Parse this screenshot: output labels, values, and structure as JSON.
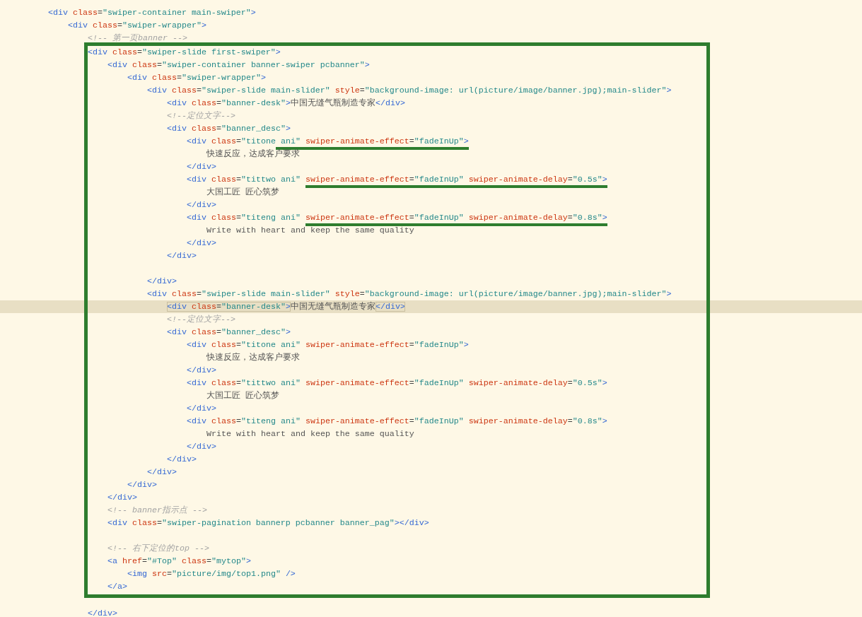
{
  "editor": {
    "lines": [
      {
        "kind": "code",
        "tokens": [
          {
            "kind": "tag",
            "text": "<div "
          },
          {
            "kind": "attr",
            "text": "class"
          },
          {
            "kind": "eq",
            "text": "="
          },
          {
            "kind": "str",
            "text": "\"swiper-container main-swiper\""
          },
          {
            "kind": "tag",
            "text": ">"
          }
        ],
        "children": [
          {
            "kind": "code",
            "tokens": [
              {
                "kind": "tag",
                "text": "<div "
              },
              {
                "kind": "attr",
                "text": "class"
              },
              {
                "kind": "eq",
                "text": "="
              },
              {
                "kind": "str",
                "text": "\"swiper-wrapper\""
              },
              {
                "kind": "tag",
                "text": ">"
              }
            ],
            "children": [
              {
                "kind": "code",
                "tokens": [
                  {
                    "kind": "comment",
                    "text": "<!-- 第一页banner -->"
                  }
                ]
              },
              {
                "kind": "code",
                "framed": true,
                "tokens": [
                  {
                    "kind": "tag",
                    "text": "<div "
                  },
                  {
                    "kind": "attr",
                    "text": "class"
                  },
                  {
                    "kind": "eq",
                    "text": "="
                  },
                  {
                    "kind": "str",
                    "text": "\"swiper-slide first-swiper\""
                  },
                  {
                    "kind": "tag",
                    "text": ">"
                  }
                ],
                "children": [
                  {
                    "kind": "code",
                    "tokens": [
                      {
                        "kind": "tag",
                        "text": "<div "
                      },
                      {
                        "kind": "attr",
                        "text": "class"
                      },
                      {
                        "kind": "eq",
                        "text": "="
                      },
                      {
                        "kind": "str",
                        "text": "\"swiper-container banner-swiper pcbanner\""
                      },
                      {
                        "kind": "tag",
                        "text": ">"
                      }
                    ],
                    "children": [
                      {
                        "kind": "code",
                        "tokens": [
                          {
                            "kind": "tag",
                            "text": "<div "
                          },
                          {
                            "kind": "attr",
                            "text": "class"
                          },
                          {
                            "kind": "eq",
                            "text": "="
                          },
                          {
                            "kind": "str",
                            "text": "\"swiper-wrapper\""
                          },
                          {
                            "kind": "tag",
                            "text": ">"
                          }
                        ],
                        "children": [
                          {
                            "kind": "code",
                            "tokens": [
                              {
                                "kind": "tag",
                                "text": "<div "
                              },
                              {
                                "kind": "attr",
                                "text": "class"
                              },
                              {
                                "kind": "eq",
                                "text": "="
                              },
                              {
                                "kind": "str",
                                "text": "\"swiper-slide main-slider\" "
                              },
                              {
                                "kind": "attr",
                                "text": "style"
                              },
                              {
                                "kind": "eq",
                                "text": "="
                              },
                              {
                                "kind": "str",
                                "text": "\"background-image: url(picture/image/banner.jpg);main-slider\""
                              },
                              {
                                "kind": "tag",
                                "text": ">"
                              }
                            ],
                            "children": [
                              {
                                "kind": "code",
                                "tokens": [
                                  {
                                    "kind": "tag",
                                    "text": "<div "
                                  },
                                  {
                                    "kind": "attr",
                                    "text": "class"
                                  },
                                  {
                                    "kind": "eq",
                                    "text": "="
                                  },
                                  {
                                    "kind": "str",
                                    "text": "\"banner-desk\""
                                  },
                                  {
                                    "kind": "tag",
                                    "text": ">"
                                  },
                                  {
                                    "kind": "text",
                                    "text": "中国无缝气瓶制造专家"
                                  },
                                  {
                                    "kind": "tag",
                                    "text": "</div>"
                                  }
                                ]
                              },
                              {
                                "kind": "code",
                                "tokens": [
                                  {
                                    "kind": "comment",
                                    "text": "<!--定位文字-->"
                                  }
                                ]
                              },
                              {
                                "kind": "code",
                                "tokens": [
                                  {
                                    "kind": "tag",
                                    "text": "<div "
                                  },
                                  {
                                    "kind": "attr",
                                    "text": "class"
                                  },
                                  {
                                    "kind": "eq",
                                    "text": "="
                                  },
                                  {
                                    "kind": "str",
                                    "text": "\"banner_desc\""
                                  },
                                  {
                                    "kind": "tag",
                                    "text": ">"
                                  }
                                ],
                                "children": [
                                  {
                                    "kind": "code",
                                    "tokens": [
                                      {
                                        "kind": "tag",
                                        "text": "<div "
                                      },
                                      {
                                        "kind": "attr",
                                        "text": "class"
                                      },
                                      {
                                        "kind": "eq",
                                        "text": "="
                                      },
                                      {
                                        "kind": "str",
                                        "text": "\"titone"
                                      },
                                      {
                                        "kind": "underline",
                                        "tokens": [
                                          {
                                            "kind": "str",
                                            "text": " ani\" "
                                          },
                                          {
                                            "kind": "attr",
                                            "text": "swiper-animate-effect"
                                          },
                                          {
                                            "kind": "eq",
                                            "text": "="
                                          },
                                          {
                                            "kind": "str",
                                            "text": "\"fadeInUp\""
                                          },
                                          {
                                            "kind": "tag",
                                            "text": ">"
                                          }
                                        ]
                                      }
                                    ],
                                    "children": [
                                      {
                                        "kind": "code",
                                        "tokens": [
                                          {
                                            "kind": "text",
                                            "text": "快速反应，达成客户要求"
                                          }
                                        ]
                                      }
                                    ]
                                  },
                                  {
                                    "kind": "code",
                                    "tokens": [
                                      {
                                        "kind": "tag",
                                        "text": "</div>"
                                      }
                                    ]
                                  },
                                  {
                                    "kind": "code",
                                    "tokens": [
                                      {
                                        "kind": "tag",
                                        "text": "<div "
                                      },
                                      {
                                        "kind": "attr",
                                        "text": "class"
                                      },
                                      {
                                        "kind": "eq",
                                        "text": "="
                                      },
                                      {
                                        "kind": "str",
                                        "text": "\"tittwo ani\" "
                                      },
                                      {
                                        "kind": "underline",
                                        "tokens": [
                                          {
                                            "kind": "attr",
                                            "text": "swiper-animate-effect"
                                          },
                                          {
                                            "kind": "eq",
                                            "text": "="
                                          },
                                          {
                                            "kind": "str",
                                            "text": "\"fadeInUp\" "
                                          },
                                          {
                                            "kind": "attr",
                                            "text": "swiper-animate-delay"
                                          },
                                          {
                                            "kind": "eq",
                                            "text": "="
                                          },
                                          {
                                            "kind": "str",
                                            "text": "\"0.5s\""
                                          },
                                          {
                                            "kind": "tag",
                                            "text": ">"
                                          }
                                        ]
                                      }
                                    ],
                                    "children": [
                                      {
                                        "kind": "code",
                                        "tokens": [
                                          {
                                            "kind": "text",
                                            "text": "大国工匠 匠心筑梦"
                                          }
                                        ]
                                      }
                                    ]
                                  },
                                  {
                                    "kind": "code",
                                    "tokens": [
                                      {
                                        "kind": "tag",
                                        "text": "</div>"
                                      }
                                    ]
                                  },
                                  {
                                    "kind": "code",
                                    "tokens": [
                                      {
                                        "kind": "tag",
                                        "text": "<div "
                                      },
                                      {
                                        "kind": "attr",
                                        "text": "class"
                                      },
                                      {
                                        "kind": "eq",
                                        "text": "="
                                      },
                                      {
                                        "kind": "str",
                                        "text": "\"titeng ani\" "
                                      },
                                      {
                                        "kind": "underline",
                                        "tokens": [
                                          {
                                            "kind": "attr",
                                            "text": "swiper-animate-effect"
                                          },
                                          {
                                            "kind": "eq",
                                            "text": "="
                                          },
                                          {
                                            "kind": "str",
                                            "text": "\"fadeInUp\" "
                                          },
                                          {
                                            "kind": "attr",
                                            "text": "swiper-animate-delay"
                                          },
                                          {
                                            "kind": "eq",
                                            "text": "="
                                          },
                                          {
                                            "kind": "str",
                                            "text": "\"0.8s\""
                                          },
                                          {
                                            "kind": "tag",
                                            "text": ">"
                                          }
                                        ]
                                      }
                                    ],
                                    "children": [
                                      {
                                        "kind": "code",
                                        "tokens": [
                                          {
                                            "kind": "text",
                                            "text": "Write with heart and keep the same quality"
                                          }
                                        ]
                                      }
                                    ]
                                  },
                                  {
                                    "kind": "code",
                                    "tokens": [
                                      {
                                        "kind": "tag",
                                        "text": "</div>"
                                      }
                                    ]
                                  }
                                ]
                              },
                              {
                                "kind": "code",
                                "tokens": [
                                  {
                                    "kind": "tag",
                                    "text": "</div>"
                                  }
                                ]
                              },
                              {
                                "kind": "blank"
                              }
                            ]
                          },
                          {
                            "kind": "code",
                            "tokens": [
                              {
                                "kind": "tag",
                                "text": "</div>"
                              }
                            ]
                          },
                          {
                            "kind": "code",
                            "tokens": [
                              {
                                "kind": "tag",
                                "text": "<div "
                              },
                              {
                                "kind": "attr",
                                "text": "class"
                              },
                              {
                                "kind": "eq",
                                "text": "="
                              },
                              {
                                "kind": "str",
                                "text": "\"swiper-slide main-slider\" "
                              },
                              {
                                "kind": "attr",
                                "text": "style"
                              },
                              {
                                "kind": "eq",
                                "text": "="
                              },
                              {
                                "kind": "str",
                                "text": "\"background-image: url(picture/image/banner.jpg);main-slider\""
                              },
                              {
                                "kind": "tag",
                                "text": ">"
                              }
                            ],
                            "children": [
                              {
                                "kind": "code",
                                "current": true,
                                "tokens": [
                                  {
                                    "kind": "match",
                                    "tokens": [
                                      {
                                        "kind": "tag",
                                        "text": "<div "
                                      },
                                      {
                                        "kind": "attr",
                                        "text": "class"
                                      },
                                      {
                                        "kind": "eq",
                                        "text": "="
                                      },
                                      {
                                        "kind": "str",
                                        "text": "\"banner-desk\""
                                      },
                                      {
                                        "kind": "tag",
                                        "text": ">"
                                      }
                                    ]
                                  },
                                  {
                                    "kind": "text",
                                    "text": "中国无缝气瓶制造专家"
                                  },
                                  {
                                    "kind": "match",
                                    "tokens": [
                                      {
                                        "kind": "tag",
                                        "text": "</div>"
                                      }
                                    ]
                                  }
                                ]
                              },
                              {
                                "kind": "code",
                                "tokens": [
                                  {
                                    "kind": "comment",
                                    "text": "<!--定位文字-->"
                                  }
                                ]
                              },
                              {
                                "kind": "code",
                                "tokens": [
                                  {
                                    "kind": "tag",
                                    "text": "<div "
                                  },
                                  {
                                    "kind": "attr",
                                    "text": "class"
                                  },
                                  {
                                    "kind": "eq",
                                    "text": "="
                                  },
                                  {
                                    "kind": "str",
                                    "text": "\"banner_desc\""
                                  },
                                  {
                                    "kind": "tag",
                                    "text": ">"
                                  }
                                ],
                                "children": [
                                  {
                                    "kind": "code",
                                    "tokens": [
                                      {
                                        "kind": "tag",
                                        "text": "<div "
                                      },
                                      {
                                        "kind": "attr",
                                        "text": "class"
                                      },
                                      {
                                        "kind": "eq",
                                        "text": "="
                                      },
                                      {
                                        "kind": "str",
                                        "text": "\"titone ani\" "
                                      },
                                      {
                                        "kind": "attr",
                                        "text": "swiper-animate-effect"
                                      },
                                      {
                                        "kind": "eq",
                                        "text": "="
                                      },
                                      {
                                        "kind": "str",
                                        "text": "\"fadeInUp\""
                                      },
                                      {
                                        "kind": "tag",
                                        "text": ">"
                                      }
                                    ],
                                    "children": [
                                      {
                                        "kind": "code",
                                        "tokens": [
                                          {
                                            "kind": "text",
                                            "text": "快速反应，达成客户要求"
                                          }
                                        ]
                                      }
                                    ]
                                  },
                                  {
                                    "kind": "code",
                                    "tokens": [
                                      {
                                        "kind": "tag",
                                        "text": "</div>"
                                      }
                                    ]
                                  },
                                  {
                                    "kind": "code",
                                    "tokens": [
                                      {
                                        "kind": "tag",
                                        "text": "<div "
                                      },
                                      {
                                        "kind": "attr",
                                        "text": "class"
                                      },
                                      {
                                        "kind": "eq",
                                        "text": "="
                                      },
                                      {
                                        "kind": "str",
                                        "text": "\"tittwo ani\" "
                                      },
                                      {
                                        "kind": "attr",
                                        "text": "swiper-animate-effect"
                                      },
                                      {
                                        "kind": "eq",
                                        "text": "="
                                      },
                                      {
                                        "kind": "str",
                                        "text": "\"fadeInUp\" "
                                      },
                                      {
                                        "kind": "attr",
                                        "text": "swiper-animate-delay"
                                      },
                                      {
                                        "kind": "eq",
                                        "text": "="
                                      },
                                      {
                                        "kind": "str",
                                        "text": "\"0.5s\""
                                      },
                                      {
                                        "kind": "tag",
                                        "text": ">"
                                      }
                                    ],
                                    "children": [
                                      {
                                        "kind": "code",
                                        "tokens": [
                                          {
                                            "kind": "text",
                                            "text": "大国工匠 匠心筑梦"
                                          }
                                        ]
                                      }
                                    ]
                                  },
                                  {
                                    "kind": "code",
                                    "tokens": [
                                      {
                                        "kind": "tag",
                                        "text": "</div>"
                                      }
                                    ]
                                  },
                                  {
                                    "kind": "code",
                                    "tokens": [
                                      {
                                        "kind": "tag",
                                        "text": "<div "
                                      },
                                      {
                                        "kind": "attr",
                                        "text": "class"
                                      },
                                      {
                                        "kind": "eq",
                                        "text": "="
                                      },
                                      {
                                        "kind": "str",
                                        "text": "\"titeng ani\" "
                                      },
                                      {
                                        "kind": "attr",
                                        "text": "swiper-animate-effect"
                                      },
                                      {
                                        "kind": "eq",
                                        "text": "="
                                      },
                                      {
                                        "kind": "str",
                                        "text": "\"fadeInUp\" "
                                      },
                                      {
                                        "kind": "attr",
                                        "text": "swiper-animate-delay"
                                      },
                                      {
                                        "kind": "eq",
                                        "text": "="
                                      },
                                      {
                                        "kind": "str",
                                        "text": "\"0.8s\""
                                      },
                                      {
                                        "kind": "tag",
                                        "text": ">"
                                      }
                                    ],
                                    "children": [
                                      {
                                        "kind": "code",
                                        "tokens": [
                                          {
                                            "kind": "text",
                                            "text": "Write with heart and keep the same quality"
                                          }
                                        ]
                                      }
                                    ]
                                  },
                                  {
                                    "kind": "code",
                                    "tokens": [
                                      {
                                        "kind": "tag",
                                        "text": "</div>"
                                      }
                                    ]
                                  }
                                ]
                              },
                              {
                                "kind": "code",
                                "tokens": [
                                  {
                                    "kind": "tag",
                                    "text": "</div>"
                                  }
                                ]
                              }
                            ]
                          },
                          {
                            "kind": "code",
                            "tokens": [
                              {
                                "kind": "tag",
                                "text": "</div>"
                              }
                            ]
                          }
                        ]
                      },
                      {
                        "kind": "code",
                        "tokens": [
                          {
                            "kind": "tag",
                            "text": "</div>"
                          }
                        ]
                      }
                    ]
                  },
                  {
                    "kind": "code",
                    "tokens": [
                      {
                        "kind": "tag",
                        "text": "</div>"
                      }
                    ]
                  },
                  {
                    "kind": "code",
                    "tokens": [
                      {
                        "kind": "comment",
                        "text": "<!-- banner指示点 -->"
                      }
                    ]
                  },
                  {
                    "kind": "code",
                    "tokens": [
                      {
                        "kind": "tag",
                        "text": "<div "
                      },
                      {
                        "kind": "attr",
                        "text": "class"
                      },
                      {
                        "kind": "eq",
                        "text": "="
                      },
                      {
                        "kind": "str",
                        "text": "\"swiper-pagination bannerp pcbanner banner_pag\""
                      },
                      {
                        "kind": "tag",
                        "text": "></div>"
                      }
                    ]
                  },
                  {
                    "kind": "blank"
                  },
                  {
                    "kind": "code",
                    "tokens": [
                      {
                        "kind": "comment",
                        "text": "<!-- 右下定位的top -->"
                      }
                    ]
                  },
                  {
                    "kind": "code",
                    "tokens": [
                      {
                        "kind": "tag",
                        "text": "<a "
                      },
                      {
                        "kind": "attr",
                        "text": "href"
                      },
                      {
                        "kind": "eq",
                        "text": "="
                      },
                      {
                        "kind": "str",
                        "text": "\"#Top\" "
                      },
                      {
                        "kind": "attr",
                        "text": "class"
                      },
                      {
                        "kind": "eq",
                        "text": "="
                      },
                      {
                        "kind": "str",
                        "text": "\"mytop\""
                      },
                      {
                        "kind": "tag",
                        "text": ">"
                      }
                    ],
                    "children": [
                      {
                        "kind": "code",
                        "tokens": [
                          {
                            "kind": "tag",
                            "text": "<img "
                          },
                          {
                            "kind": "attr",
                            "text": "src"
                          },
                          {
                            "kind": "eq",
                            "text": "="
                          },
                          {
                            "kind": "str",
                            "text": "\"picture/img/top1.png\" "
                          },
                          {
                            "kind": "tag",
                            "text": "/>"
                          }
                        ]
                      }
                    ]
                  },
                  {
                    "kind": "code",
                    "tokens": [
                      {
                        "kind": "tag",
                        "text": "</a>"
                      }
                    ]
                  }
                ]
              },
              {
                "kind": "blank"
              },
              {
                "kind": "code",
                "tokens": [
                  {
                    "kind": "tag",
                    "text": "</div>"
                  }
                ]
              }
            ]
          }
        ]
      }
    ]
  }
}
